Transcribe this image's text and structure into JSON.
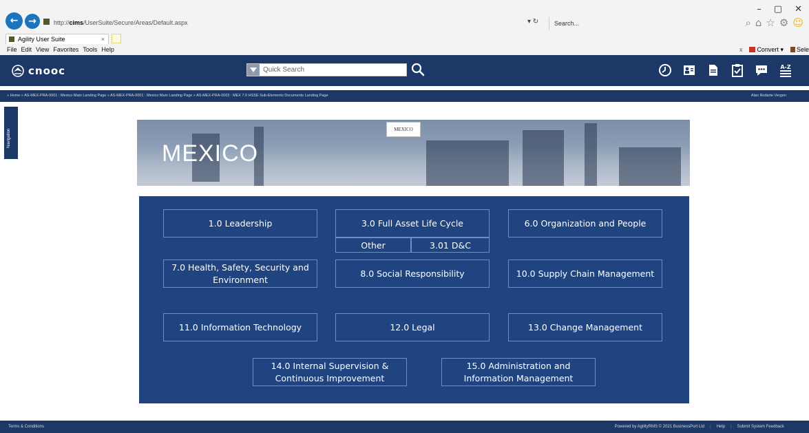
{
  "browser": {
    "url_prefix": "http://",
    "url_host": "cims",
    "url_path": "/UserSuite/Secure/Areas/Default.aspx",
    "search_placeholder": "Search...",
    "tab_title": "Agility User Suite",
    "menu": [
      "File",
      "Edit",
      "View",
      "Favorites",
      "Tools",
      "Help"
    ],
    "convert_label": "Convert",
    "select_label": "Sele"
  },
  "app": {
    "logo_text": "cnooc",
    "quick_search_placeholder": "Quick Search",
    "breadcrumb": "» Home » AS-MEX-PRA-0001 : Mexico Main Landing Page » AS-MEX-PRA-0001 : Mexico Main Landing Page » AS-MEX-PRA-0003 : MEX 7.0 HSSE Sub-Elements Documents Landing Page",
    "user_name": "Alan Rodarte Vergen",
    "nav_tab_label": "Navigation"
  },
  "banner": {
    "title": "MEXICO",
    "chip": "MEXICO"
  },
  "tiles": {
    "leadership": "1.0 Leadership",
    "asset_life_cycle": "3.0 Full Asset Life Cycle",
    "other": "Other",
    "dc": "3.01 D&C",
    "organization": "6.0 Organization and People",
    "hsse": "7.0 Health, Safety, Security and Environment",
    "social": "8.0 Social Responsibility",
    "supply_chain": "10.0 Supply Chain Management",
    "it": "11.0 Information Technology",
    "legal": "12.0 Legal",
    "change": "13.0 Change Management",
    "supervision": "14.0 Internal Supervision & Continuous Improvement",
    "administration": "15.0 Administration and Information Management"
  },
  "footer": {
    "terms": "Terms & Conditions",
    "powered": "Powered by AgilityRMS © 2021 BusinessPort Ltd",
    "help": "Help",
    "feedback": "Submit System Feedback"
  }
}
